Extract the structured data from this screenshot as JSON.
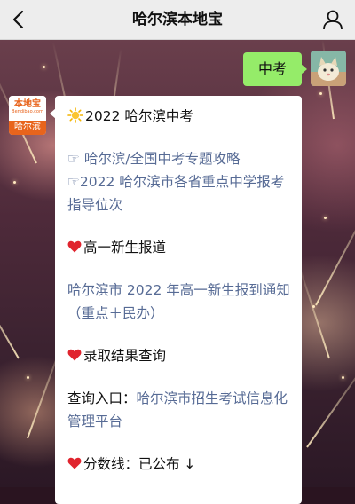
{
  "navbar": {
    "title": "哈尔滨本地宝",
    "back_icon": "chevron-left-icon",
    "user_icon": "user-icon"
  },
  "chat": {
    "outgoing": {
      "text": "中考"
    },
    "incoming_avatar": {
      "brand_cn": "本地宝",
      "brand_en": "Bendibao.com",
      "city": "哈尔滨"
    },
    "incoming": {
      "heading": "2022 哈尔滨中考",
      "link1_prefix": "☞ ",
      "link1": "哈尔滨/全国中考专题攻略",
      "link2_prefix": "☞",
      "link2": "2022 哈尔滨市各省重点中学报考指导位次",
      "section1": "高一新生报道",
      "section1_link": "哈尔滨市 2022 年高一新生报到通知（重点＋民办）",
      "section2": "录取结果查询",
      "query_label": "查询入口：",
      "query_link": "哈尔滨市招生考试信息化管理平台",
      "section3": "分数线：已公布 ↓"
    }
  },
  "colors": {
    "navbar": "#ededed",
    "outgoing_bubble": "#95ec69",
    "link": "#576b95",
    "brand_orange": "#e8641c",
    "heart": "#e0242e"
  }
}
